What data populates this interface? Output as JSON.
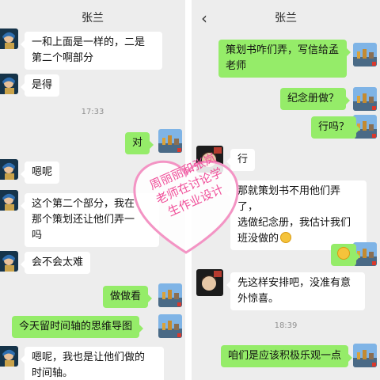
{
  "left_panel": {
    "title": "张兰",
    "messages": [
      {
        "side": "in",
        "text": "一和上面是一样的，二是\n第二个啊部分"
      },
      {
        "side": "in",
        "text": "是得"
      },
      {
        "side": "out",
        "text": "对"
      },
      {
        "side": "in",
        "text": "嗯呢"
      },
      {
        "side": "in",
        "text": "这个第二个部分，我在\n那个策划还让他们弄一\n吗"
      },
      {
        "side": "in",
        "text": "会不会太难"
      },
      {
        "side": "out",
        "text": "做做看"
      },
      {
        "side": "out",
        "text": "今天留时间轴的思维导图"
      },
      {
        "side": "in",
        "text": "嗯呢，我也是让他们做的\n时间轴。"
      }
    ],
    "timestamps": [
      "17:33"
    ]
  },
  "right_panel": {
    "title": "张兰",
    "back_icon": "chevron-left-icon",
    "messages": [
      {
        "side": "out",
        "text": "策划书咋们弄，写信给孟\n老师"
      },
      {
        "side": "out",
        "text": "纪念册做？"
      },
      {
        "side": "out",
        "text": "行吗？"
      },
      {
        "side": "in",
        "text": "行"
      },
      {
        "side": "in",
        "text": "那就策划书不用他们弄了，\n选做纪念册，我估计我们\n班没做的"
      },
      {
        "side": "out",
        "text": ""
      },
      {
        "side": "in",
        "text": "先这样安排吧，没准有意\n外惊喜。"
      },
      {
        "side": "out",
        "text": "咱们是应该积极乐观一点"
      }
    ],
    "timestamps": [
      "18:39"
    ]
  },
  "watermark": {
    "text": "周丽丽和张岚\n老师在讨论学\n生作业设计",
    "color": "#f0509a"
  },
  "colors": {
    "background": "#ededed",
    "incoming_bubble": "#ffffff",
    "outgoing_bubble": "#95ec69"
  }
}
